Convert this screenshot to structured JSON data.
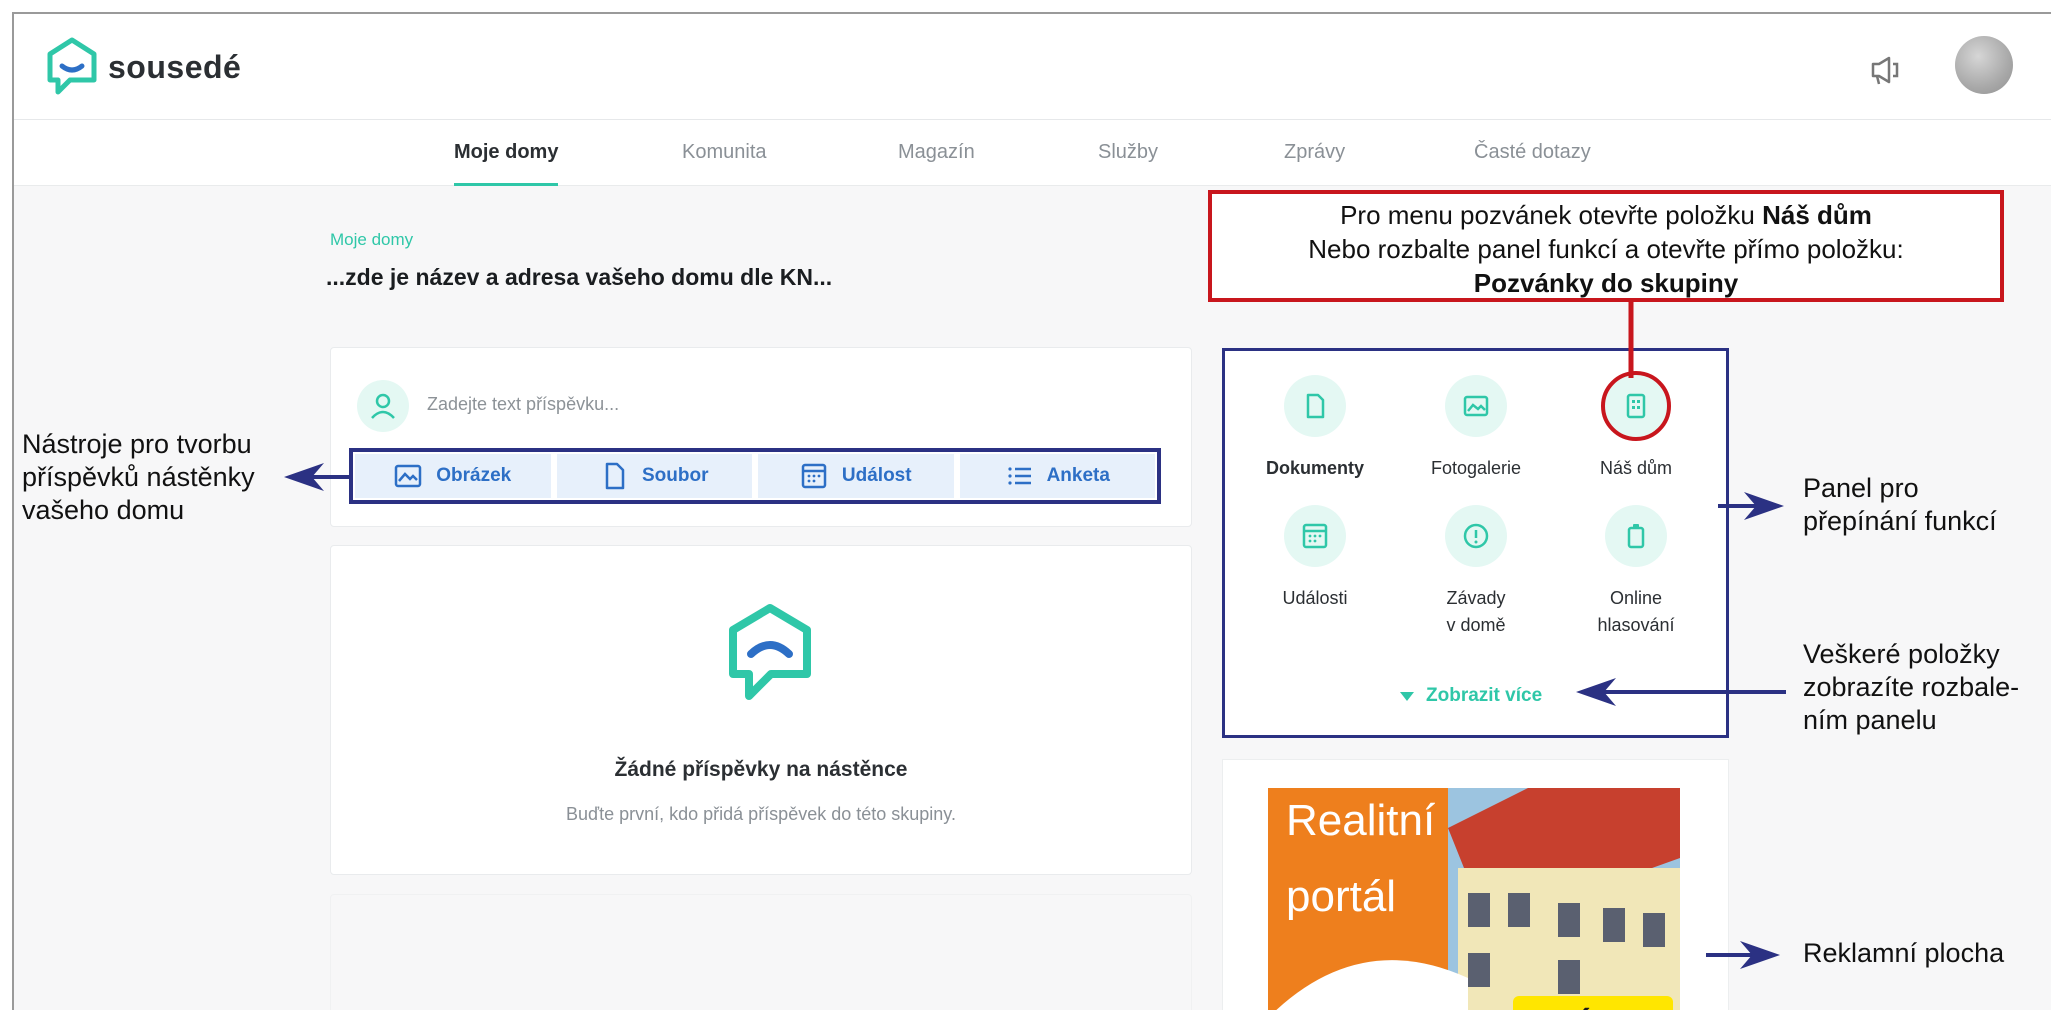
{
  "brand": {
    "name": "sousedé",
    "accent": "#2fc7a8",
    "annotation_blue": "#2b3183",
    "annotation_red": "#c8161d"
  },
  "header": {
    "megaphone_icon": "megaphone-icon",
    "avatar": "user-avatar"
  },
  "nav": {
    "items": [
      {
        "label": "Moje domy",
        "active": true
      },
      {
        "label": "Komunita",
        "active": false
      },
      {
        "label": "Magazín",
        "active": false
      },
      {
        "label": "Služby",
        "active": false
      },
      {
        "label": "Zprávy",
        "active": false
      },
      {
        "label": "Časté dotazy",
        "active": false
      }
    ]
  },
  "page": {
    "breadcrumb": "Moje domy",
    "title": "...zde je název a adresa vašeho domu dle KN..."
  },
  "composer": {
    "placeholder": "Zadejte text příspěvku...",
    "tools": [
      {
        "label": "Obrázek",
        "icon": "image-icon"
      },
      {
        "label": "Soubor",
        "icon": "file-icon"
      },
      {
        "label": "Událost",
        "icon": "calendar-icon"
      },
      {
        "label": "Anketa",
        "icon": "list-icon"
      }
    ]
  },
  "wall": {
    "empty_title": "Žádné příspěvky na nástěnce",
    "empty_subtitle": "Buďte první, kdo přidá příspěvek do této skupiny."
  },
  "functions": {
    "items": [
      {
        "label": "Dokumenty",
        "icon": "document-icon",
        "bold": true
      },
      {
        "label": "Fotogalerie",
        "icon": "gallery-icon",
        "bold": false
      },
      {
        "label": "Náš dům",
        "icon": "building-icon",
        "bold": false
      },
      {
        "label": "Události",
        "icon": "calendar-icon",
        "bold": false
      },
      {
        "label_line1": "Závady",
        "label_line2": "v domě",
        "icon": "alert-icon",
        "bold": false
      },
      {
        "label_line1": "Online",
        "label_line2": "hlasování",
        "icon": "ballot-icon",
        "bold": false
      }
    ],
    "show_more": "Zobrazit více"
  },
  "ad": {
    "line1": "Realitní",
    "line2": "portál",
    "button": "více"
  },
  "annotations": {
    "callout_line1_pre": "Pro menu pozvánek otevřte položku ",
    "callout_line1_bold": "Náš dům",
    "callout_line2": "Nebo rozbalte panel funkcí a otevřte přímo položku:",
    "callout_line3": "Pozvánky do skupiny",
    "tools_note": [
      "Nástroje pro tvorbu",
      "příspěvků nástěnky",
      "vašeho domu"
    ],
    "panel_note": [
      "Panel pro",
      "přepínání funkcí"
    ],
    "more_note": [
      "Veškeré položky",
      "zobrazíte rozbale-",
      "ním panelu"
    ],
    "ad_note": "Reklamní plocha"
  }
}
